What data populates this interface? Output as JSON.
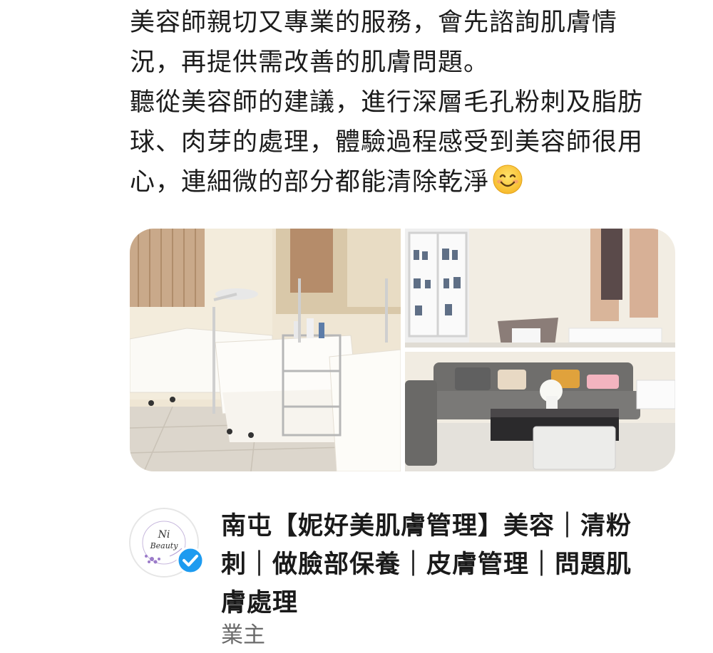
{
  "review": {
    "lines": [
      "美容師親切又專業的服務，會先諮詢肌膚情",
      "況，再提供需改善的肌膚問題。",
      "聽從美容師的建議，進行深層毛孔粉刺及脂肪",
      "球、肉芽的處理，體驗過程感受到美容師很用",
      "心，連細微的部分都能清除乾淨"
    ],
    "emoji": "smiling-face-emoji"
  },
  "photos": [
    {
      "name": "treatment-room-photo"
    },
    {
      "name": "display-cabinet-room-photo"
    },
    {
      "name": "lounge-sofa-photo"
    }
  ],
  "business": {
    "name_lines": [
      "南屯【妮好美肌膚管理】美容｜清粉",
      "刺｜做臉部保養｜皮膚管理｜問題肌",
      "膚處理"
    ],
    "role": "業主",
    "logo_text": "Ni Beauty",
    "verified": true,
    "colors": {
      "verified_badge": "#1d9bf0",
      "logo_accent": "#9b7bc9"
    }
  }
}
